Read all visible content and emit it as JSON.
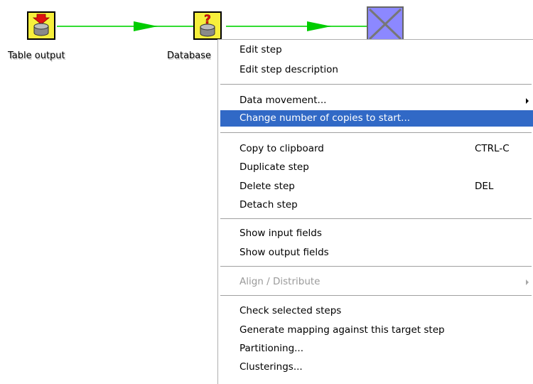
{
  "canvas": {
    "steps": [
      {
        "label": "Table output",
        "icon": "table-output-icon"
      },
      {
        "label": "Database",
        "icon": "database-lookup-icon"
      },
      {
        "label": "",
        "icon": "unknown-step-icon"
      }
    ]
  },
  "context_menu": {
    "items": [
      {
        "label": "Edit step"
      },
      {
        "label": "Edit step description"
      },
      {
        "label": "Data movement..."
      },
      {
        "label": "Change number of copies to start..."
      },
      {
        "label": "Copy to clipboard",
        "shortcut": "CTRL-C"
      },
      {
        "label": "Duplicate step"
      },
      {
        "label": "Delete step",
        "shortcut": "DEL"
      },
      {
        "label": "Detach step"
      },
      {
        "label": "Show input fields"
      },
      {
        "label": "Show output fields"
      },
      {
        "label": "Align / Distribute"
      },
      {
        "label": "Check selected steps"
      },
      {
        "label": "Generate mapping against this target step"
      },
      {
        "label": "Partitioning..."
      },
      {
        "label": "Clusterings..."
      }
    ],
    "highlight_color": "#3169c6",
    "disabled_color": "#9a9a9a"
  },
  "colors": {
    "hop_line": "#33dd33",
    "hop_arrow": "#00cc00",
    "step_yellow": "#f7ef3c",
    "step_blue": "#8c88ff"
  }
}
